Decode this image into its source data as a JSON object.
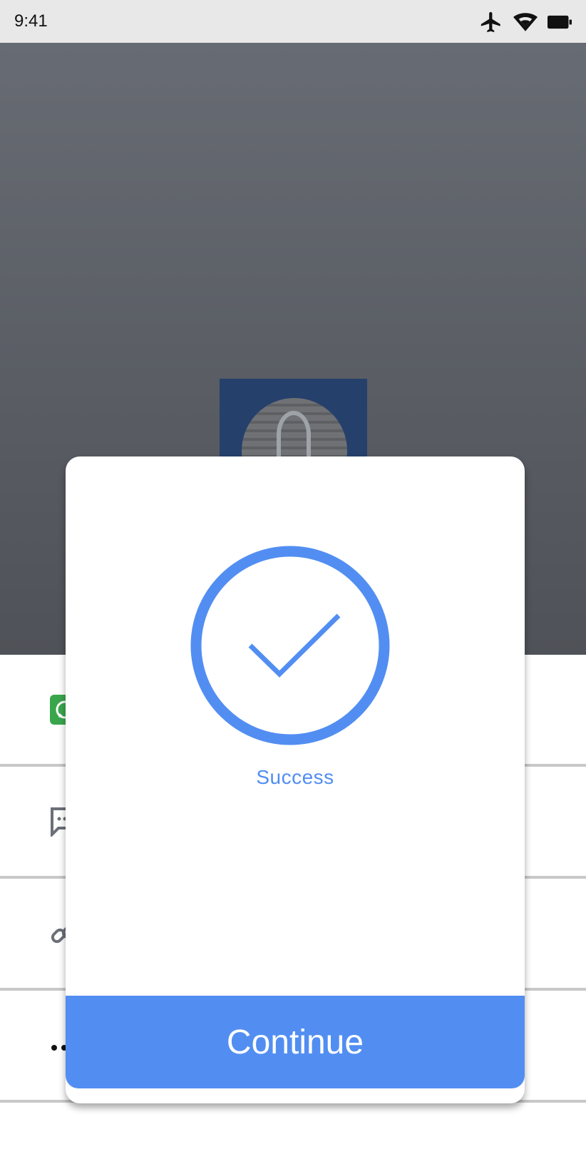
{
  "status_bar": {
    "time": "9:41",
    "icons": [
      "airplane-icon",
      "wifi-icon",
      "battery-icon"
    ]
  },
  "share_options": [
    {
      "icon": "whatsapp-icon",
      "label": ""
    },
    {
      "icon": "message-icon",
      "label": ""
    },
    {
      "icon": "link-icon",
      "label": ""
    },
    {
      "icon": "more-icon",
      "label": ""
    }
  ],
  "dialog": {
    "icon": "checkmark-circle-icon",
    "status_text": "Success",
    "continue_label": "Continue"
  },
  "colors": {
    "accent": "#528ef2",
    "whatsapp_green": "#3aa64c",
    "backdrop_top": "#676b73",
    "backdrop_bottom": "#4f5258"
  }
}
